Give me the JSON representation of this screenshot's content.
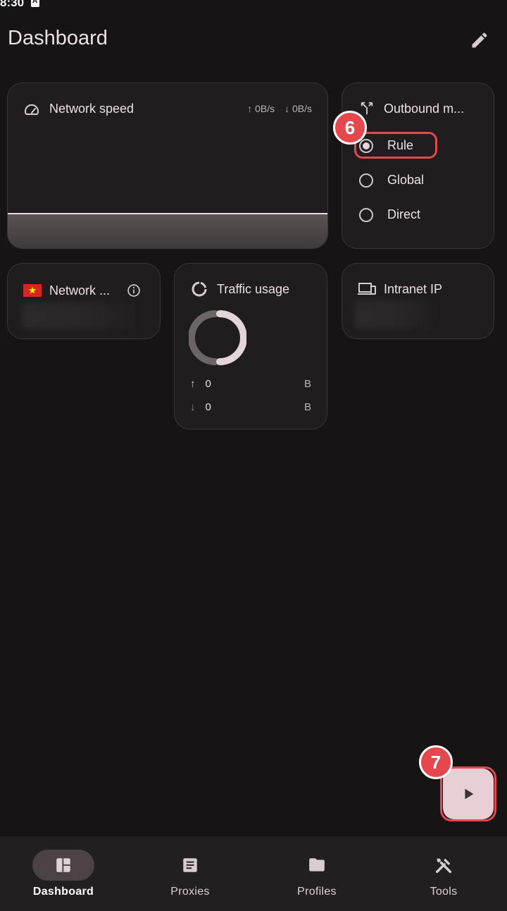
{
  "status_bar": {
    "time": "8:30"
  },
  "header": {
    "title": "Dashboard",
    "edit_icon": "pencil-icon"
  },
  "network_speed": {
    "title": "Network speed",
    "upload": "↑ 0B/s",
    "download": "↓ 0B/s",
    "icon": "speedometer-icon"
  },
  "outbound_mode": {
    "title": "Outbound m...",
    "icon": "fork-arrows-icon",
    "options": [
      {
        "label": "Rule",
        "selected": true
      },
      {
        "label": "Global",
        "selected": false
      },
      {
        "label": "Direct",
        "selected": false
      }
    ]
  },
  "network_detection": {
    "title": "Network ...",
    "flag_icon": "vietnam-flag-icon",
    "info_icon": "info-icon"
  },
  "traffic_usage": {
    "title": "Traffic usage",
    "icon": "donut-chart-icon",
    "upload_value": "0",
    "upload_unit": "B",
    "download_value": "0",
    "download_unit": "B"
  },
  "intranet_ip": {
    "title": "Intranet IP",
    "icon": "devices-icon"
  },
  "annotations": {
    "badge_rule": "6",
    "badge_fab": "7"
  },
  "fab": {
    "icon": "play-icon"
  },
  "bottom_nav": [
    {
      "label": "Dashboard",
      "icon": "dashboard-icon",
      "active": true
    },
    {
      "label": "Proxies",
      "icon": "article-icon",
      "active": false
    },
    {
      "label": "Profiles",
      "icon": "folder-icon",
      "active": false
    },
    {
      "label": "Tools",
      "icon": "tools-icon",
      "active": false
    }
  ],
  "colors": {
    "background": "#161415",
    "card": "#201D1E",
    "accent": "#E8CFD5",
    "highlight": "#E5474C"
  }
}
